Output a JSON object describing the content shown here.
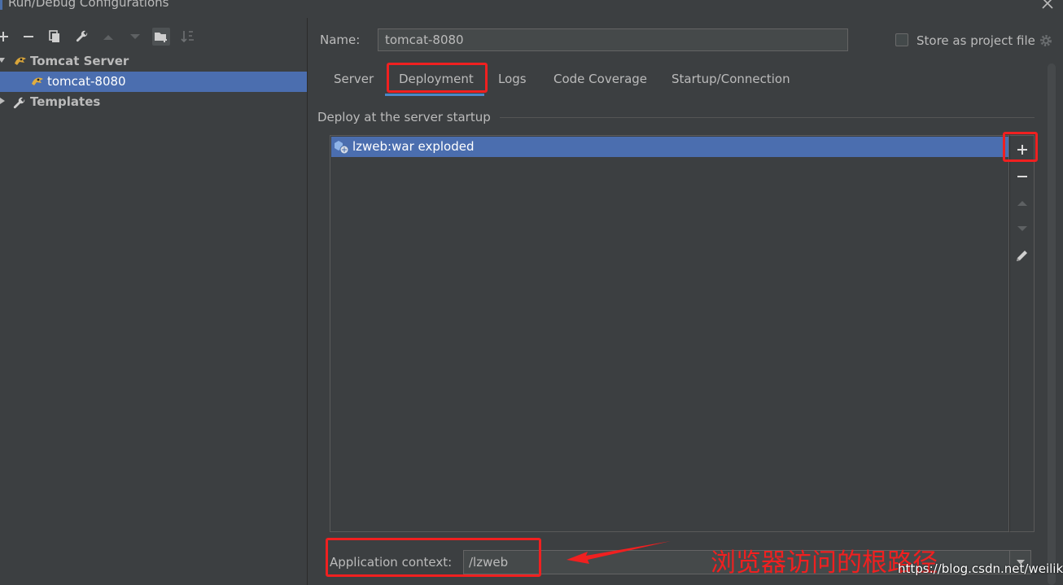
{
  "window": {
    "title": "Run/Debug Configurations"
  },
  "toolbar": {
    "buttons": [
      "add-icon",
      "remove-icon",
      "copy-icon",
      "wrench-icon",
      "move-up-icon",
      "move-down-icon",
      "folder-icon",
      "sort-icon"
    ]
  },
  "tree": {
    "group_label": "Tomcat Server",
    "child_label": "tomcat-8080",
    "templates_label": "Templates"
  },
  "form": {
    "name_label": "Name:",
    "name_value": "tomcat-8080",
    "store_label": "Store as project file",
    "store_checked": false
  },
  "tabs": [
    {
      "label": "Server"
    },
    {
      "label": "Deployment",
      "active": true
    },
    {
      "label": "Logs"
    },
    {
      "label": "Code Coverage"
    },
    {
      "label": "Startup/Connection"
    }
  ],
  "deployment": {
    "section_title": "Deploy at the server startup",
    "items": [
      {
        "label": "lzweb:war exploded",
        "selected": true
      }
    ]
  },
  "app_context": {
    "label": "Application context:",
    "value": "/lzweb"
  },
  "annotations": {
    "note": "浏览器访问的根路径",
    "watermark": "https://blog.csdn.net/weilikk",
    "color": "#f02020"
  },
  "colors": {
    "background": "#3c3f41",
    "selection": "#4b6eaf",
    "text": "#bbbbbb",
    "tab_underline": "#4a88c7"
  }
}
